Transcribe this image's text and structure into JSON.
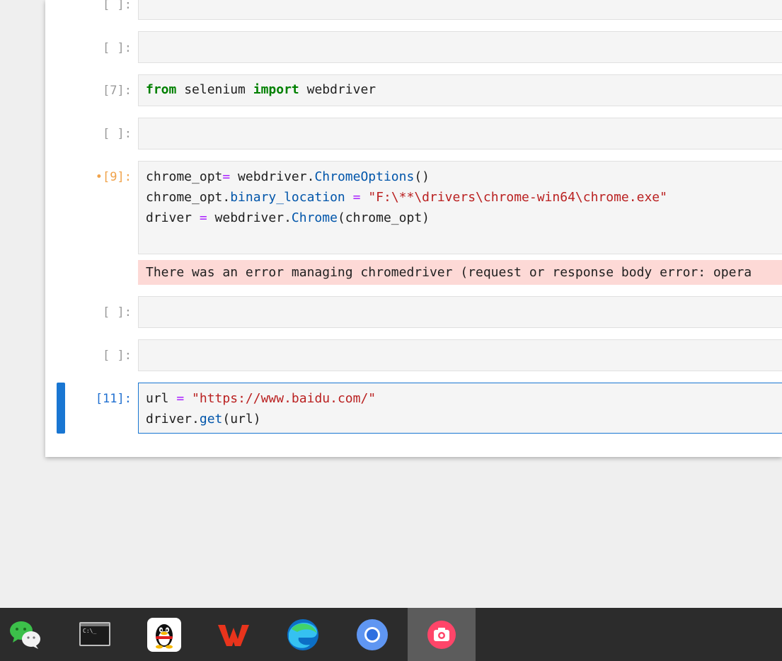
{
  "notebook": {
    "cells": [
      {
        "prompt": "[ ]:",
        "state": "idle"
      },
      {
        "prompt": "[ ]:",
        "state": "idle"
      },
      {
        "prompt": "[7]:",
        "state": "executed",
        "code": {
          "t1": "from",
          "t2": " selenium ",
          "t3": "import",
          "t4": " webdriver"
        }
      },
      {
        "prompt": "[ ]:",
        "state": "idle"
      },
      {
        "prompt": "[9]:",
        "state": "dirty",
        "code": {
          "l1a": "chrome_opt",
          "l1b": "=",
          "l1c": " webdriver.",
          "l1d": "ChromeOptions",
          "l1e": "()",
          "l2a": "chrome_opt.",
          "l2b": "binary_location",
          "l2c": " ",
          "l2d": "=",
          "l2e": " ",
          "l2f": "\"F:\\**\\drivers\\chrome-win64\\chrome.exe\"",
          "l3a": "driver ",
          "l3b": "=",
          "l3c": " webdriver.",
          "l3d": "Chrome",
          "l3e": "(chrome_opt)"
        },
        "output_error": "There was an error managing chromedriver (request or response body error: opera"
      },
      {
        "prompt": "[ ]:",
        "state": "idle"
      },
      {
        "prompt": "[ ]:",
        "state": "idle"
      },
      {
        "prompt": "[11]:",
        "state": "active",
        "code": {
          "l1a": "url ",
          "l1b": "=",
          "l1c": " ",
          "l1d": "\"https://www.baidu.com/\"",
          "l2a": "driver.",
          "l2b": "get",
          "l2c": "(url)"
        }
      }
    ],
    "dirty_marker": "•"
  },
  "taskbar": {
    "items": [
      {
        "icon": "wechat-icon"
      },
      {
        "icon": "terminal-icon",
        "label": "C:\\_"
      },
      {
        "icon": "qq-icon"
      },
      {
        "icon": "wps-office-icon"
      },
      {
        "icon": "edge-browser-icon"
      },
      {
        "icon": "chromium-browser-icon"
      },
      {
        "icon": "screenshot-camera-icon",
        "active": true
      }
    ]
  },
  "colors": {
    "keyword": "#008000",
    "operator": "#aa22ff",
    "attribute": "#0055aa",
    "string": "#ba2121",
    "error_bg": "#fdd9d6",
    "active_border": "#1976d2",
    "dirty_prompt": "#f0a24a"
  }
}
